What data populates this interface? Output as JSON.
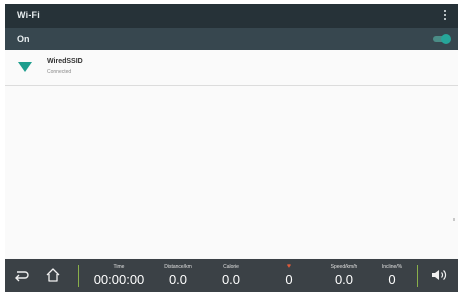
{
  "header": {
    "title": "Wi-Fi",
    "menu_icon": "more-vert-icon"
  },
  "wifi_switch": {
    "label": "On",
    "enabled": true,
    "accent": "#26a69a"
  },
  "networks": [
    {
      "name": "WiredSSID",
      "status": "Connected",
      "icon": "wifi-signal-icon",
      "icon_color": "#1e9e8e"
    }
  ],
  "bottom_bar": {
    "back_icon": "back-arrow-icon",
    "home_icon": "home-icon",
    "volume_icon": "volume-icon",
    "heart_icon": "heart-icon",
    "separator_color": "#8ab04a",
    "metrics": {
      "time": {
        "label": "Time",
        "value": "00:00:00"
      },
      "distance": {
        "label": "Distance/km",
        "value": "0.0"
      },
      "calorie": {
        "label": "Calorie",
        "value": "0.0"
      },
      "heart_rate": {
        "label": "",
        "value": "0"
      },
      "speed": {
        "label": "Speed/km/h",
        "value": "0.0"
      },
      "incline": {
        "label": "Incline/%",
        "value": "0"
      }
    }
  }
}
